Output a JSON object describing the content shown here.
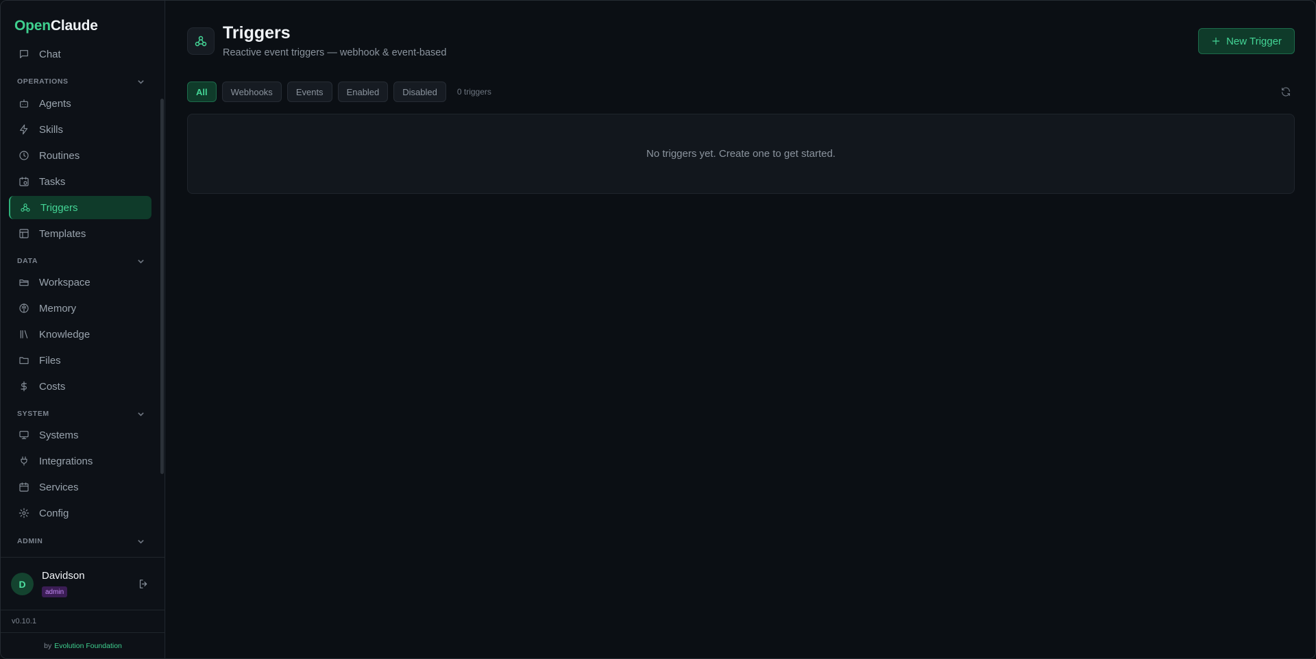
{
  "brand": {
    "part1": "Open",
    "part2": "Claude"
  },
  "sidebar": {
    "partial_item": {
      "label": "Chat",
      "icon": "chat-icon"
    },
    "sections": [
      {
        "label": "OPERATIONS",
        "items": [
          {
            "label": "Agents",
            "icon": "bot-icon"
          },
          {
            "label": "Skills",
            "icon": "lightning-icon"
          },
          {
            "label": "Routines",
            "icon": "clock-icon"
          },
          {
            "label": "Tasks",
            "icon": "calendar-clock-icon"
          },
          {
            "label": "Triggers",
            "icon": "webhook-icon",
            "active": true
          },
          {
            "label": "Templates",
            "icon": "layout-icon"
          }
        ]
      },
      {
        "label": "DATA",
        "items": [
          {
            "label": "Workspace",
            "icon": "folder-open-icon"
          },
          {
            "label": "Memory",
            "icon": "brain-icon"
          },
          {
            "label": "Knowledge",
            "icon": "library-icon"
          },
          {
            "label": "Files",
            "icon": "folder-icon"
          },
          {
            "label": "Costs",
            "icon": "dollar-icon"
          }
        ]
      },
      {
        "label": "SYSTEM",
        "items": [
          {
            "label": "Systems",
            "icon": "monitor-icon"
          },
          {
            "label": "Integrations",
            "icon": "plug-icon"
          },
          {
            "label": "Services",
            "icon": "calendar-icon"
          },
          {
            "label": "Config",
            "icon": "gear-icon"
          }
        ]
      },
      {
        "label": "ADMIN",
        "items": []
      }
    ]
  },
  "user": {
    "initial": "D",
    "name": "Davidson",
    "role": "admin"
  },
  "version": "v0.10.1",
  "footer": {
    "by": "by",
    "org": "Evolution Foundation"
  },
  "page": {
    "title": "Triggers",
    "subtitle": "Reactive event triggers — webhook & event-based",
    "new_button": "New Trigger",
    "filters": [
      "All",
      "Webhooks",
      "Events",
      "Enabled",
      "Disabled"
    ],
    "active_filter": "All",
    "count": "0 triggers",
    "empty_message": "No triggers yet. Create one to get started."
  },
  "colors": {
    "accent": "#44d596",
    "active_bg": "#0f3b2a",
    "badge_purple": "#c38bf5"
  }
}
